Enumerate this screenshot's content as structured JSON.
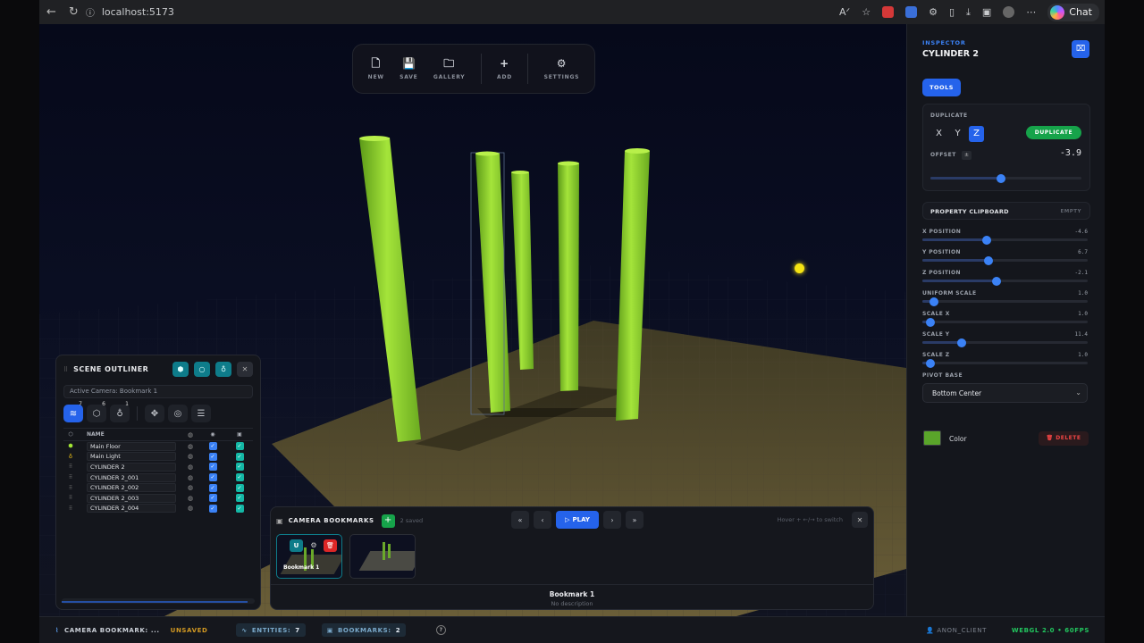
{
  "browser": {
    "url": "localhost:5173",
    "chat_label": "Chat"
  },
  "toolbar": {
    "new_label": "NEW",
    "save_label": "SAVE",
    "gallery_label": "GALLERY",
    "add_label": "ADD",
    "settings_label": "SETTINGS"
  },
  "outliner": {
    "title": "SCENE OUTLINER",
    "active_camera": "Active Camera: Bookmark 1",
    "tab_counts": [
      "7",
      "6",
      "1"
    ],
    "col_name": "NAME",
    "rows": [
      {
        "icon": "mesh-icon",
        "name": "Main Floor"
      },
      {
        "icon": "light-icon",
        "name": "Main Light"
      },
      {
        "icon": "drag-icon",
        "name": "CYLINDER 2"
      },
      {
        "icon": "drag-icon",
        "name": "CYLINDER 2_001"
      },
      {
        "icon": "drag-icon",
        "name": "CYLINDER 2_002"
      },
      {
        "icon": "drag-icon",
        "name": "CYLINDER 2_003"
      },
      {
        "icon": "drag-icon",
        "name": "CYLINDER 2_004"
      }
    ]
  },
  "bookmarks": {
    "title": "CAMERA BOOKMARKS",
    "saved": "2 saved",
    "play_label": "PLAY",
    "hint": "Hover + ←/→ to switch",
    "thumb1_label": "Bookmark 1",
    "thumb1_badge": "U",
    "selected_name": "Bookmark 1",
    "selected_desc": "No description"
  },
  "inspector": {
    "subtitle": "INSPECTOR",
    "title": "CYLINDER 2",
    "tools_label": "TOOLS",
    "duplicate_section": "DUPLICATE",
    "axes": [
      "X",
      "Y",
      "Z"
    ],
    "active_axis": "Z",
    "duplicate_btn": "DUPLICATE",
    "offset_label": "OFFSET",
    "offset_pm": "±",
    "offset_value": "-3.9",
    "clipboard_label": "PROPERTY CLIPBOARD",
    "clipboard_state": "EMPTY",
    "properties": [
      {
        "label": "X POSITION",
        "value": "-4.6"
      },
      {
        "label": "Y POSITION",
        "value": "6.7"
      },
      {
        "label": "Z POSITION",
        "value": "-2.1"
      },
      {
        "label": "UNIFORM SCALE",
        "value": "1.0"
      },
      {
        "label": "SCALE X",
        "value": "1.0"
      },
      {
        "label": "SCALE Y",
        "value": "11.4"
      },
      {
        "label": "SCALE Z",
        "value": "1.0"
      }
    ],
    "pivot_label": "PIVOT BASE",
    "pivot_value": "Bottom Center",
    "color_label": "Color",
    "color_value": "#5aa52a",
    "delete_label": "DELETE"
  },
  "status": {
    "camera_bookmark": "CAMERA BOOKMARK: ...",
    "unsaved": "UNSAVED",
    "entities_label": "ENTITIES:",
    "entities_count": "7",
    "bookmarks_label": "BOOKMARKS:",
    "bookmarks_count": "2",
    "user": "ANON_CLIENT",
    "renderer": "WEBGL 2.0 • 60FPS"
  }
}
